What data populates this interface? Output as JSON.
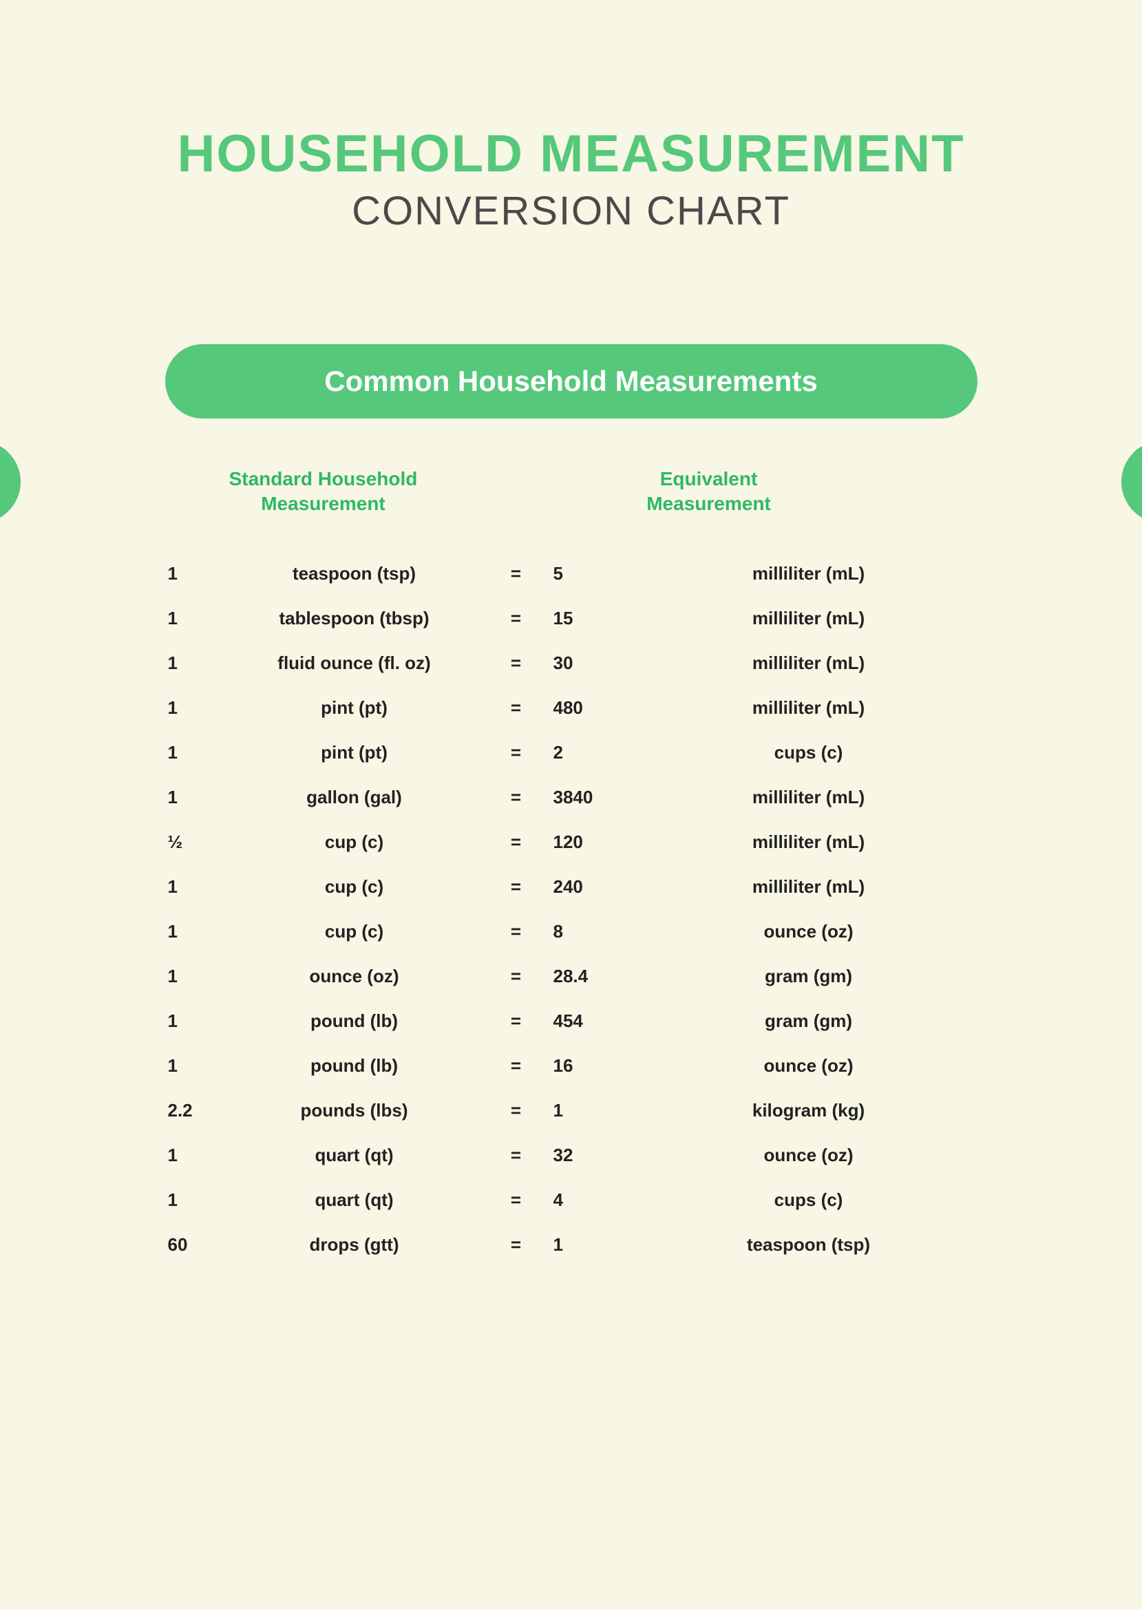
{
  "title": {
    "line1": "HOUSEHOLD MEASUREMENT",
    "line2": "CONVERSION CHART"
  },
  "section_header": "Common Household Measurements",
  "columns": {
    "left": "Standard Household\nMeasurement",
    "right": "Equivalent\nMeasurement"
  },
  "equals": "=",
  "rows": [
    {
      "q1": "1",
      "u1": "teaspoon (tsp)",
      "q2": "5",
      "u2": "milliliter (mL)"
    },
    {
      "q1": "1",
      "u1": "tablespoon (tbsp)",
      "q2": "15",
      "u2": "milliliter (mL)"
    },
    {
      "q1": "1",
      "u1": "fluid ounce (fl. oz)",
      "q2": "30",
      "u2": "milliliter (mL)"
    },
    {
      "q1": "1",
      "u1": "pint (pt)",
      "q2": "480",
      "u2": "milliliter (mL)"
    },
    {
      "q1": "1",
      "u1": "pint (pt)",
      "q2": "2",
      "u2": "cups (c)"
    },
    {
      "q1": "1",
      "u1": "gallon (gal)",
      "q2": "3840",
      "u2": "milliliter (mL)"
    },
    {
      "q1": "½",
      "u1": "cup (c)",
      "q2": "120",
      "u2": "milliliter (mL)"
    },
    {
      "q1": "1",
      "u1": "cup (c)",
      "q2": "240",
      "u2": "milliliter (mL)"
    },
    {
      "q1": "1",
      "u1": "cup (c)",
      "q2": "8",
      "u2": "ounce (oz)"
    },
    {
      "q1": "1",
      "u1": "ounce (oz)",
      "q2": "28.4",
      "u2": "gram (gm)"
    },
    {
      "q1": "1",
      "u1": "pound (lb)",
      "q2": "454",
      "u2": "gram (gm)"
    },
    {
      "q1": "1",
      "u1": "pound (lb)",
      "q2": "16",
      "u2": "ounce (oz)"
    },
    {
      "q1": "2.2",
      "u1": "pounds (lbs)",
      "q2": "1",
      "u2": "kilogram (kg)"
    },
    {
      "q1": "1",
      "u1": "quart (qt)",
      "q2": "32",
      "u2": "ounce (oz)"
    },
    {
      "q1": "1",
      "u1": "quart (qt)",
      "q2": "4",
      "u2": "cups (c)"
    },
    {
      "q1": "60",
      "u1": "drops (gtt)",
      "q2": "1",
      "u2": "teaspoon (tsp)"
    }
  ]
}
